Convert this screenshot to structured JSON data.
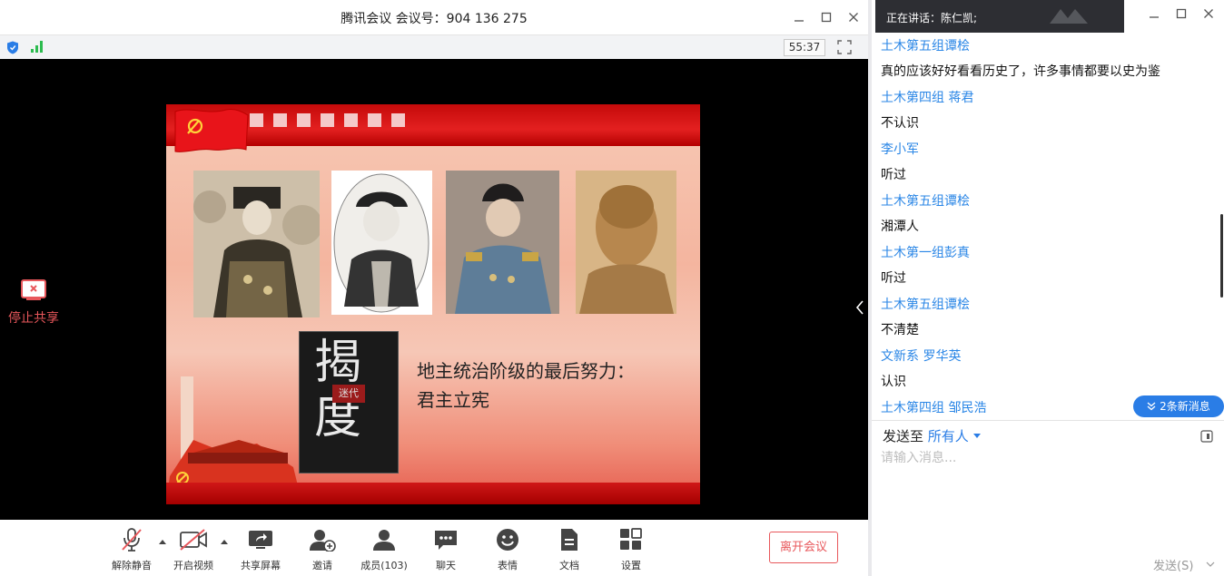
{
  "meeting": {
    "title": "腾讯会议 会议号：904 136 275",
    "timer": "55:37",
    "stop_share_label": "停止共享"
  },
  "slide": {
    "caption_line1": "地主统治阶级的最后努力：",
    "caption_line2": "君主立宪",
    "book_title": "揭度",
    "book_subtitle": "迷代"
  },
  "toolbar": {
    "unmute": "解除静音",
    "start_video": "开启视频",
    "share_screen": "共享屏幕",
    "invite": "邀请",
    "members": "成员(103)",
    "chat": "聊天",
    "reactions": "表情",
    "documents": "文档",
    "settings": "设置",
    "leave": "离开会议"
  },
  "chat": {
    "speaking": "正在讲话：陈仁凯;",
    "messages": [
      {
        "name": "土木第五组谭桧",
        "text": "真的应该好好看看历史了，许多事情都要以史为鉴"
      },
      {
        "name": "土木第四组  蒋君",
        "text": "不认识"
      },
      {
        "name": "李小军",
        "text": "听过"
      },
      {
        "name": "土木第五组谭桧",
        "text": "湘潭人"
      },
      {
        "name": "土木第一组彭真",
        "text": "听过"
      },
      {
        "name": "土木第五组谭桧",
        "text": "不清楚"
      },
      {
        "name": "文新系 罗华英",
        "text": "认识"
      },
      {
        "name": "土木第四组 邹民浩",
        "text": ""
      }
    ],
    "new_messages": "2条新消息",
    "send_to_label": "发送至",
    "send_to_target": "所有人",
    "input_placeholder": "请输入消息...",
    "send_label": "发送(S)"
  },
  "colors": {
    "accent": "#2a7de6",
    "danger": "#e8575b",
    "slide_red": "#d41414"
  }
}
